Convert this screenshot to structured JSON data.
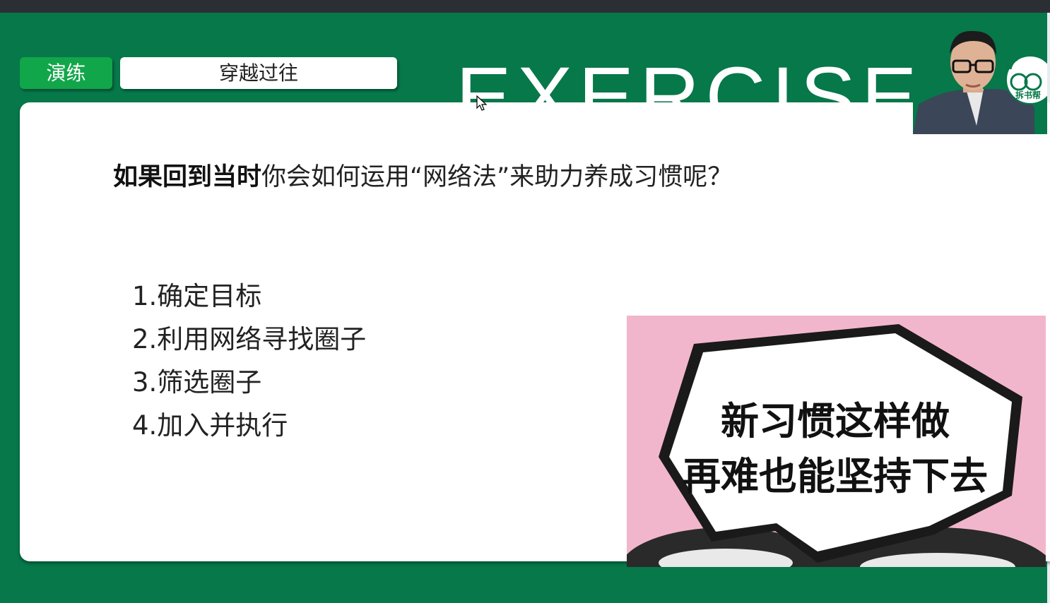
{
  "slide": {
    "tag_label": "演练",
    "title": "穿越过往",
    "watermark": "EXERCISE",
    "question_bold": "如果回到当时",
    "question_rest": "你会如何运用“网络法”来助力养成习惯呢？",
    "steps": [
      "1.确定目标",
      "2.利用网络寻找圈子",
      "3.筛选圈子",
      "4.加入并执行"
    ]
  },
  "thumbnail": {
    "line1": "新习惯这样做",
    "line2": "再难也能坚持下去"
  },
  "webcam": {
    "logo_text": "拆书帮"
  },
  "colors": {
    "slide_green": "#06784a",
    "tag_green": "#12a64a",
    "thumbnail_pink": "#f2b6cc"
  }
}
